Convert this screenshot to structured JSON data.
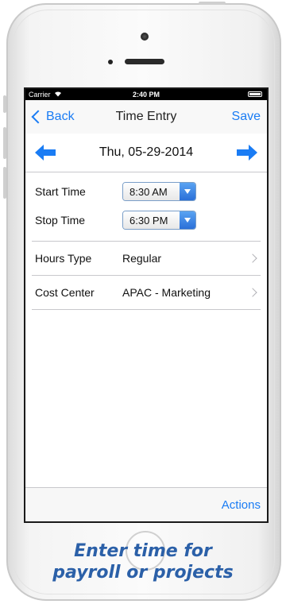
{
  "status_bar": {
    "carrier": "Carrier",
    "time": "2:40 PM"
  },
  "navbar": {
    "back_label": "Back",
    "title": "Time Entry",
    "save_label": "Save"
  },
  "date_nav": {
    "date": "Thu, 05-29-2014",
    "prev_icon": "arrow-left-icon",
    "next_icon": "arrow-right-icon"
  },
  "times": {
    "start_label": "Start Time",
    "start_value": "8:30 AM",
    "stop_label": "Stop Time",
    "stop_value": "6:30 PM"
  },
  "rows": [
    {
      "label": "Hours Type",
      "value": "Regular"
    },
    {
      "label": "Cost Center",
      "value": "APAC - Marketing"
    }
  ],
  "toolbar": {
    "actions_label": "Actions"
  },
  "caption": {
    "line1": "Enter time for",
    "line2": "payroll or projects"
  },
  "colors": {
    "accent": "#1a7cf4",
    "caption": "#2b60a8"
  }
}
